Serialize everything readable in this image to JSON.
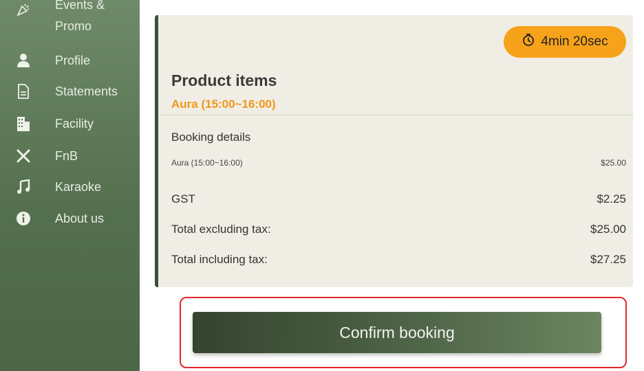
{
  "sidebar": {
    "items": [
      {
        "label": "Events &",
        "icon": "confetti-icon"
      },
      {
        "label": "Promo",
        "icon": ""
      },
      {
        "label": "Profile",
        "icon": "user-icon"
      },
      {
        "label": "Statements",
        "icon": "document-icon"
      },
      {
        "label": "Facility",
        "icon": "building-icon"
      },
      {
        "label": "FnB",
        "icon": "utensils-icon"
      },
      {
        "label": "Karaoke",
        "icon": "music-note-icon"
      },
      {
        "label": "About us",
        "icon": "info-icon"
      }
    ]
  },
  "order": {
    "timer": "4min 20sec",
    "section_title": "Product items",
    "subtitle": "Aura (15:00~16:00)",
    "booking_title": "Booking details",
    "line_item": {
      "label": "Aura (15:00~16:00)",
      "value": "$25.00"
    },
    "gst": {
      "label": "GST",
      "value": "$2.25"
    },
    "total_excl": {
      "label": "Total excluding tax:",
      "value": "$25.00"
    },
    "total_incl": {
      "label": "Total including tax:",
      "value": "$27.25"
    }
  },
  "actions": {
    "confirm_label": "Confirm booking"
  },
  "colors": {
    "accent": "#f2961a",
    "timer_bg": "#f7a21b",
    "sidebar": "#55704f",
    "button": "#3f5239",
    "highlight": "#e2262b"
  }
}
